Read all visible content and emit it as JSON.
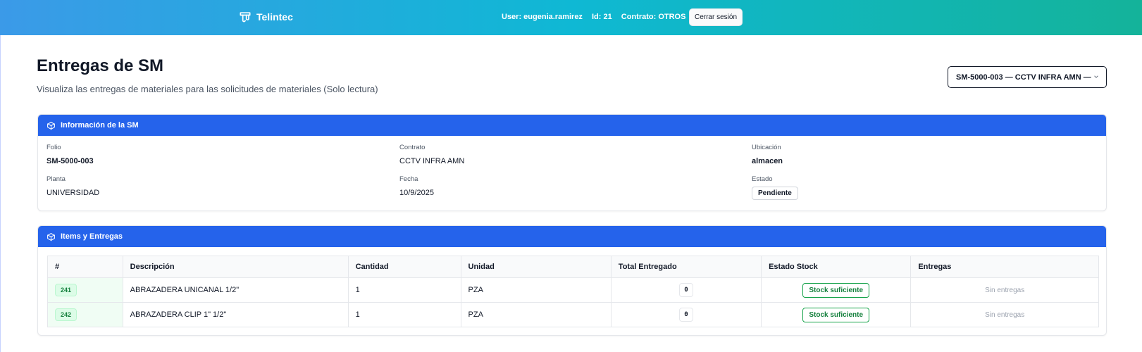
{
  "header": {
    "brand": "Telintec",
    "user": "User: eugenia.ramirez",
    "id": "Id: 21",
    "contract": "Contrato: OTROS",
    "logout_label": "Cerrar sesión"
  },
  "page": {
    "title": "Entregas de SM",
    "subtitle": "Visualiza las entregas de materiales para las solicitudes de materiales (Solo lectura)",
    "selected_sm": "SM-5000-003 — CCTV INFRA AMN —"
  },
  "info": {
    "heading": "Información de la SM",
    "folio_label": "Folio",
    "folio": "SM-5000-003",
    "contrato_label": "Contrato",
    "contrato": "CCTV INFRA AMN",
    "ubicacion_label": "Ubicación",
    "ubicacion": "almacen",
    "planta_label": "Planta",
    "planta": "UNIVERSIDAD",
    "fecha_label": "Fecha",
    "fecha": "10/9/2025",
    "estado_label": "Estado",
    "estado": "Pendiente"
  },
  "items": {
    "heading": "Items y Entregas",
    "columns": [
      "#",
      "Descripción",
      "Cantidad",
      "Unidad",
      "Total Entregado",
      "Estado Stock",
      "Entregas"
    ],
    "rows": [
      {
        "id": "241",
        "descripcion": "ABRAZADERA UNICANAL 1/2\"",
        "cantidad": "1",
        "unidad": "PZA",
        "entregado": "0",
        "stock": "Stock suficiente",
        "entregas": "Sin entregas"
      },
      {
        "id": "242",
        "descripcion": "ABRAZADERA CLIP 1\" 1/2\"",
        "cantidad": "1",
        "unidad": "PZA",
        "entregado": "0",
        "stock": "Stock suficiente",
        "entregas": "Sin entregas"
      }
    ]
  },
  "colors": {
    "header_gradient_start": "#3b9ae8",
    "header_gradient_end": "#14b39a",
    "card_header": "#2563eb",
    "stock_ok": "#15803d"
  }
}
